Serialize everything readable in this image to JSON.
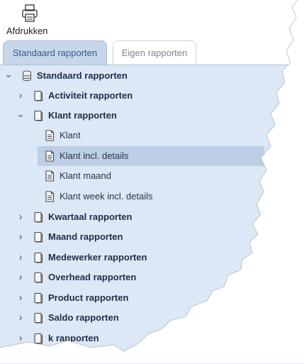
{
  "toolbar": {
    "print_label": "Afdrukken"
  },
  "tabs": [
    {
      "label": "Standaard rapporten",
      "active": true
    },
    {
      "label": "Eigen rapporten",
      "active": false
    }
  ],
  "tree": {
    "root": {
      "label": "Standaard rapporten",
      "icon": "database-icon",
      "expanded": true
    },
    "items": [
      {
        "label": "Activiteit rapporten",
        "icon": "notebook-icon",
        "expanded": false
      },
      {
        "label": "Klant rapporten",
        "icon": "notebook-icon",
        "expanded": true,
        "children": [
          {
            "label": "Klant",
            "icon": "report-icon"
          },
          {
            "label": "Klant incl. details",
            "icon": "report-icon",
            "selected": true
          },
          {
            "label": "Klant maand",
            "icon": "report-icon"
          },
          {
            "label": "Klant week incl. details",
            "icon": "report-icon"
          }
        ]
      },
      {
        "label": "Kwartaal rapporten",
        "icon": "notebook-icon",
        "expanded": false
      },
      {
        "label": "Maand rapporten",
        "icon": "notebook-icon",
        "expanded": false
      },
      {
        "label": "Medewerker rapporten",
        "icon": "notebook-icon",
        "expanded": false
      },
      {
        "label": "Overhead rapporten",
        "icon": "notebook-icon",
        "expanded": false
      },
      {
        "label": "Product rapporten",
        "icon": "notebook-icon",
        "expanded": false
      },
      {
        "label": "Saldo rapporten",
        "icon": "notebook-icon",
        "expanded": false
      },
      {
        "label": "k rapporten",
        "icon": "notebook-icon",
        "expanded": false
      }
    ]
  },
  "colors": {
    "panel": "#dce8f5",
    "selected": "#bccfe6",
    "tab_active": "#c6d7ea",
    "accent": "#2d5c8c"
  }
}
